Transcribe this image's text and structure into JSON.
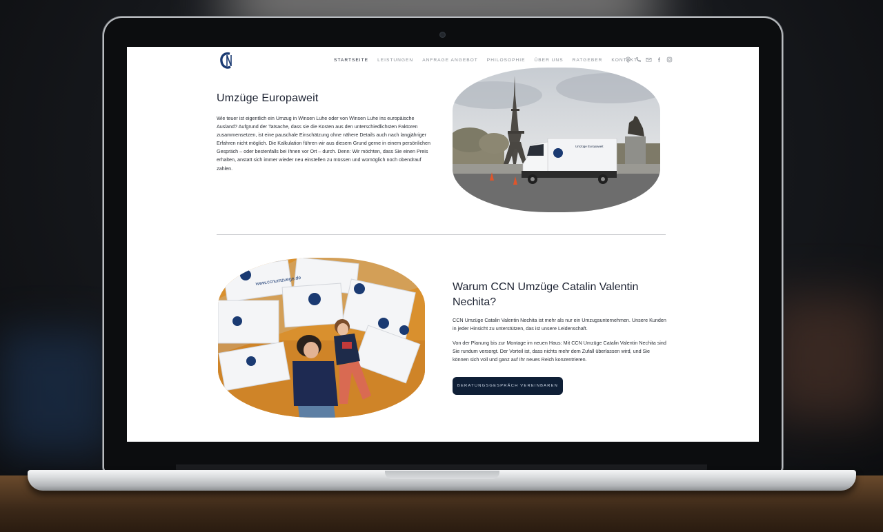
{
  "site": {
    "logo_alt": "CCN Umzüge"
  },
  "nav": {
    "items": [
      "STARTSEITE",
      "LEISTUNGEN",
      "ANFRAGE ANGEBOT",
      "PHILOSOPHIE",
      "ÜBER UNS",
      "RATGEBER",
      "KONTAKT"
    ],
    "active": "STARTSEITE"
  },
  "social_icons": [
    "location-icon",
    "phone-icon",
    "mail-icon",
    "facebook-icon",
    "instagram-icon"
  ],
  "section_europe": {
    "title": "Umzüge  Europaweit",
    "body": "Wie teuer ist eigentlich ein Umzug in Winsen Luhe oder von Winsen Luhe ins europäische Ausland? Aufgrund der Tatsache, dass sie die Kosten aus den unterschiedlichsten Faktoren zusammensetzen, ist eine pauschale Einschätzung ohne nähere Details auch nach langjähriger Erfahren nicht möglich. Die Kalkulation führen wir aus diesem Grund gerne in einem persönlichen Gespräch – oder bestenfalls bei Ihnen vor Ort – durch. Denn: Wir möchten, dass Sie einen Preis erhalten, anstatt sich immer wieder neu einstellen zu müssen und womöglich noch obendrauf zahlen.",
    "image_caption": "Umzüge Europaweit"
  },
  "section_why": {
    "title": "Warum CCN Umzüge Catalin Valentin Nechita?",
    "body_1": "CCN Umzüge Catalin Valentin Nechita ist mehr als nur ein Umzugsunternehmen. Unsere Kunden in jeder Hinsicht zu unterstützen, das ist unsere Leidenschaft.",
    "body_2": "Von der Planung bis zur Montage im neuen Haus: Mit CCN Umzüge Catalin Valentin Nechita sind Sie rundum versorgt. Der Vorteil ist, dass nichts mehr dem Zufall überlassen wird, und Sie können sich voll und ganz auf Ihr neues Reich konzentrieren.",
    "cta_label": "BERATUNGSGESPRÄCH VEREINBAREN",
    "box_text": "www.ccnumzuege.de"
  },
  "colors": {
    "brand_dark": "#0f1f36",
    "heading": "#1b2130",
    "nav_inactive": "#8a8f96"
  }
}
